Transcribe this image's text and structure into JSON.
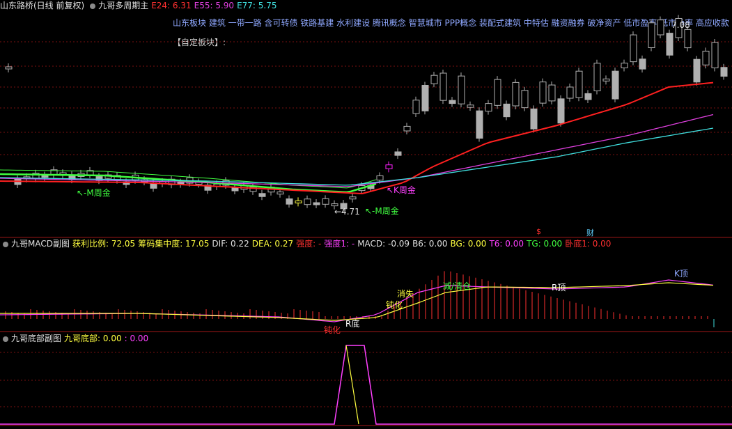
{
  "main": {
    "stock": "山东路桥(日线 前复权)",
    "indicator": "九哥多周期主",
    "e24": "E24: 6.31",
    "e55": "E55: 5.90",
    "e77": "E77: 5.75",
    "tags": "山东板块 建筑 一带一路 含可转债 铁路基建 水利建设 腾讯概念 智慧城市 PPP概念 装配式建筑 中特估 融资融券 破净资产 低市盈率 低市净率 高应收款 东",
    "custom_block": "【自定板块】:",
    "labels": {
      "m_gold_left": "↖-M周金",
      "k_gold": "↖K周金",
      "m_gold_right": "↖-M周金",
      "low_price": "←4.71",
      "high_price": "7.08",
      "marker_s": "$",
      "marker_cai": "财"
    },
    "colors": {
      "e24": "#ff2020",
      "e55": "#e040e0",
      "e77": "#40e0e0"
    }
  },
  "macd": {
    "title": "九哥MACD副图",
    "profit": "获利比例: 72.05",
    "chip": "筹码集中度: 17.05",
    "dif": "DIF: 0.22",
    "dea": "DEA: 0.27",
    "strong": "强度: -",
    "strong1": "强度1: -",
    "macd": "MACD: -0.09",
    "b6": "B6: 0.00",
    "bg": "BG: 0.00",
    "t6": "T6: 0.00",
    "tg": "TG: 0.00",
    "wodi": "卧底1: 0.00",
    "labels": {
      "dunhua_low": "钝化",
      "r_bottom": "R底",
      "dunhua": "钝化",
      "xiaoshi": "消失",
      "jian_qingcang": "减/清仓",
      "r_top": "R顶",
      "k_top": "K顶"
    }
  },
  "bottom": {
    "title": "九哥底部副图",
    "val1": "九哥底部: 0.00",
    "val2": ": 0.00"
  }
}
